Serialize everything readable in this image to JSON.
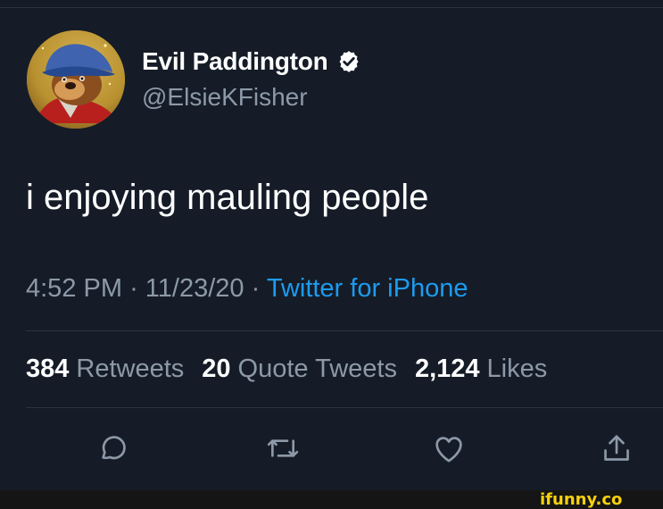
{
  "tweet": {
    "display_name": "Evil Paddington",
    "handle": "@ElsieKFisher",
    "verified": true,
    "text": "i enjoying mauling people",
    "time": "4:52 PM",
    "separator": "·",
    "date": "11/23/20",
    "source": "Twitter for iPhone",
    "stats": {
      "retweets_count": "384",
      "retweets_label": "Retweets",
      "quote_count": "20",
      "quote_label": "Quote Tweets",
      "likes_count": "2,124",
      "likes_label": "Likes"
    }
  },
  "icons": {
    "avatar": "paddington-bear-avatar",
    "verified": "verified-badge-icon",
    "reply": "reply-icon",
    "retweet": "retweet-icon",
    "like": "heart-icon",
    "share": "share-icon"
  },
  "colors": {
    "background": "#151c27",
    "text": "#ffffff",
    "secondary_text": "#8d99a8",
    "link": "#1d9bf0",
    "divider": "#2b3441",
    "watermark": "#f8d10b"
  },
  "watermark": "ifunny.co"
}
